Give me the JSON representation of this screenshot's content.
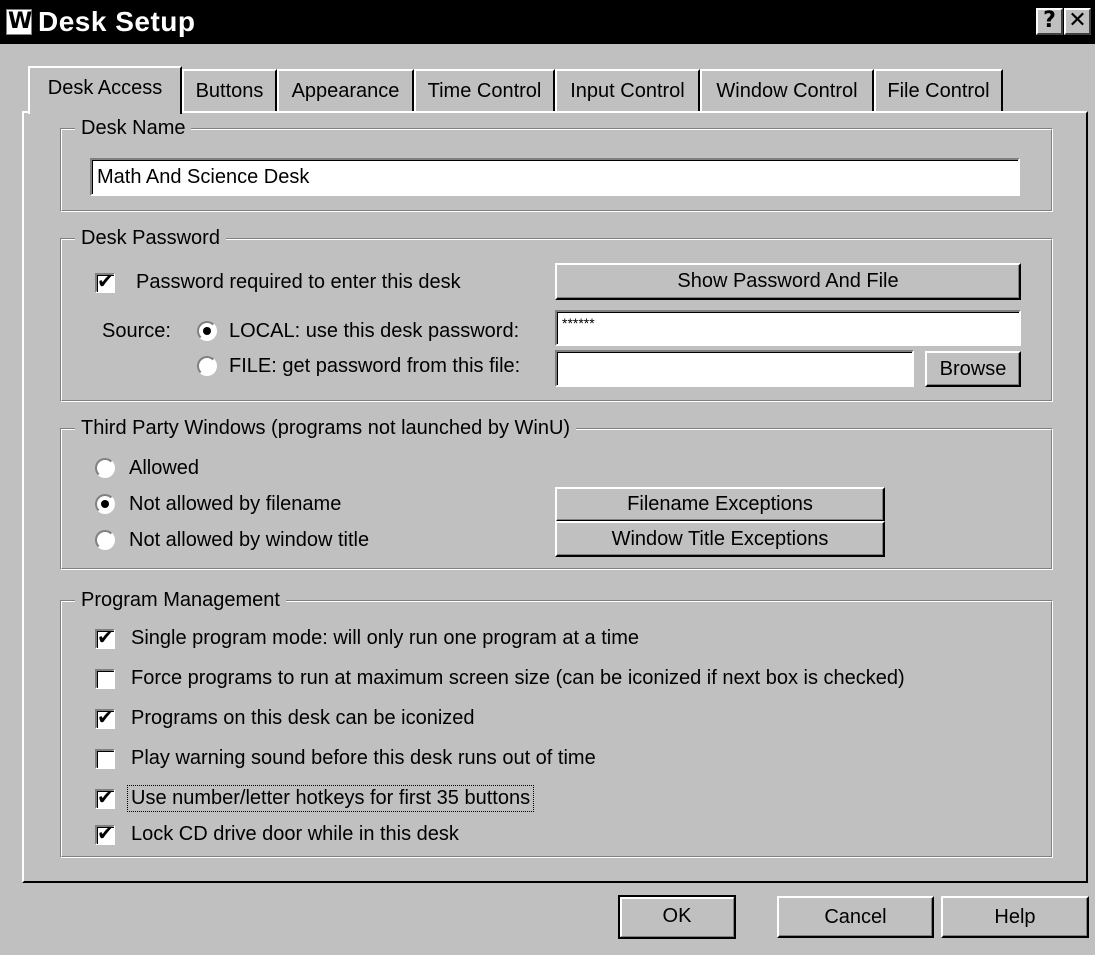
{
  "window": {
    "app_icon_letter": "W",
    "title": "Desk Setup",
    "help_glyph": "?",
    "close_glyph": "✕"
  },
  "tabs": [
    {
      "label": "Desk Access",
      "active": true
    },
    {
      "label": "Buttons",
      "active": false
    },
    {
      "label": "Appearance",
      "active": false
    },
    {
      "label": "Time Control",
      "active": false
    },
    {
      "label": "Input Control",
      "active": false
    },
    {
      "label": "Window Control",
      "active": false
    },
    {
      "label": "File Control",
      "active": false
    }
  ],
  "desk_name": {
    "legend": "Desk Name",
    "value": "Math And Science Desk"
  },
  "desk_password": {
    "legend": "Desk Password",
    "required_label": "Password required to enter this desk",
    "required_checked": true,
    "show_button": "Show Password And File",
    "source_label": "Source:",
    "local_label": "LOCAL: use this desk password:",
    "local_selected": true,
    "local_value": "******",
    "file_label": "FILE: get password from this file:",
    "file_selected": false,
    "file_value": "",
    "browse_button": "Browse"
  },
  "third_party": {
    "legend": "Third Party Windows (programs not launched by WinU)",
    "options": [
      {
        "label": "Allowed",
        "selected": false
      },
      {
        "label": "Not allowed by filename",
        "selected": true
      },
      {
        "label": "Not allowed by window title",
        "selected": false
      }
    ],
    "filename_exceptions_button": "Filename Exceptions",
    "window_title_exceptions_button": "Window Title Exceptions"
  },
  "program_management": {
    "legend": "Program Management",
    "options": [
      {
        "label": "Single program mode: will only run one program at a time",
        "checked": true
      },
      {
        "label": "Force programs to run at maximum screen size (can be iconized if next box is checked)",
        "checked": false
      },
      {
        "label": "Programs on this desk can be iconized",
        "checked": true
      },
      {
        "label": "Play warning sound before this desk runs out of time",
        "checked": false
      },
      {
        "label": "Use number/letter hotkeys for first 35 buttons",
        "checked": true
      },
      {
        "label": "Lock CD drive door while in this desk",
        "checked": true
      }
    ]
  },
  "footer": {
    "ok": "OK",
    "cancel": "Cancel",
    "help": "Help"
  },
  "check_glyph": "✔"
}
